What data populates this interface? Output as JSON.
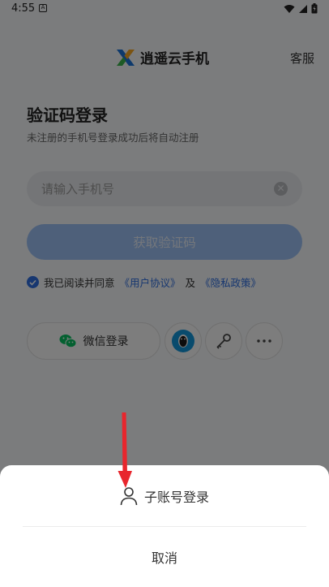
{
  "status_bar": {
    "time": "4:55",
    "notification_letter": "A"
  },
  "header": {
    "app_name": "逍遥云手机",
    "service_label": "客服"
  },
  "login": {
    "title": "验证码登录",
    "subtitle": "未注册的手机号登录成功后将自动注册",
    "phone_placeholder": "请输入手机号",
    "get_code_label": "获取验证码",
    "agreement": {
      "prefix": "我已阅读并同意",
      "user_agreement": "《用户协议》",
      "and": "及",
      "privacy_policy": "《隐私政策》",
      "checked": true
    },
    "wechat_label": "微信登录"
  },
  "bottom_sheet": {
    "sub_account_label": "子账号登录",
    "cancel_label": "取消"
  },
  "colors": {
    "accent": "#2f6fe0",
    "button_disabled": "#9cc1f5",
    "wechat": "#07c160",
    "qq": "#1296db",
    "annotation_arrow": "#e8262d"
  },
  "icons": [
    "x-logo-icon",
    "close-icon",
    "checkmark-icon",
    "wechat-icon",
    "qq-icon",
    "key-icon",
    "more-icon",
    "user-icon",
    "wifi-icon",
    "signal-icon",
    "battery-icon"
  ]
}
